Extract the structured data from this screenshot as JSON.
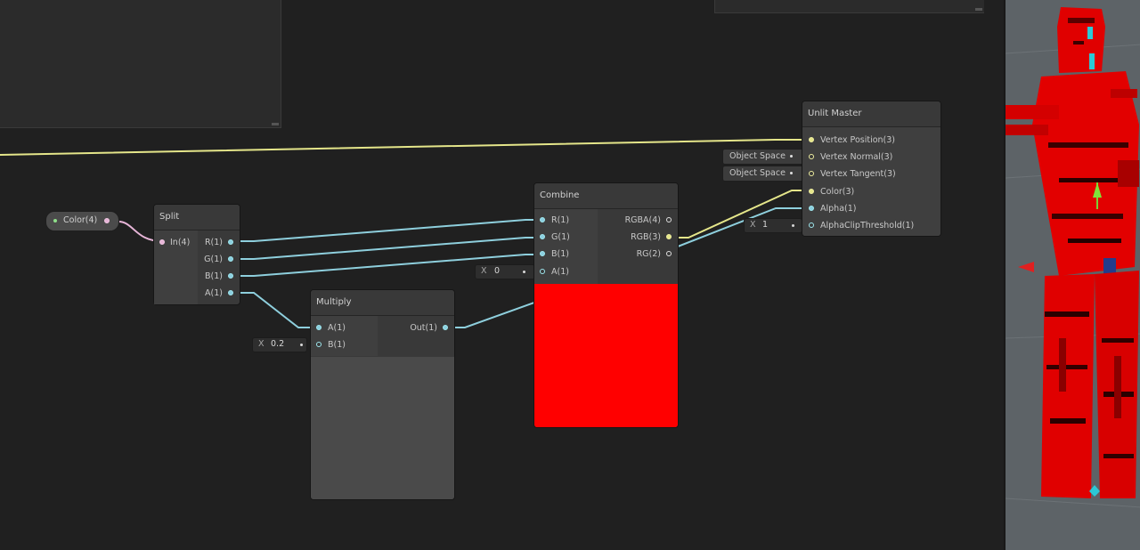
{
  "nodes": {
    "unlit_master": {
      "title": "Unlit Master",
      "inputs": [
        "Vertex Position(3)",
        "Vertex Normal(3)",
        "Vertex Tangent(3)",
        "Color(3)",
        "Alpha(1)",
        "AlphaClipThreshold(1)"
      ],
      "space_chips": [
        "Object Space",
        "Object Space"
      ],
      "alpha_clip_field": {
        "label": "X",
        "value": "1"
      }
    },
    "split": {
      "title": "Split",
      "input": "In(4)",
      "outputs": [
        "R(1)",
        "G(1)",
        "B(1)",
        "A(1)"
      ]
    },
    "combine": {
      "title": "Combine",
      "inputs": [
        "R(1)",
        "G(1)",
        "B(1)",
        "A(1)"
      ],
      "outputs": [
        "RGBA(4)",
        "RGB(3)",
        "RG(2)"
      ],
      "a_field": {
        "label": "X",
        "value": "0"
      },
      "preview_color": "#ff0000"
    },
    "multiply": {
      "title": "Multiply",
      "inputs": [
        "A(1)",
        "B(1)"
      ],
      "output": "Out(1)",
      "b_field": {
        "label": "X",
        "value": "0.2"
      }
    },
    "color_property": {
      "label": "Color(4)"
    }
  },
  "colors": {
    "wire_float": "#8ecfdd",
    "wire_vector3": "#e5e68a",
    "wire_vector4": "#e7b5d8",
    "graph_background": "#202020",
    "node_background": "#393939",
    "preview_red": "#ff0000",
    "scene_background": "#5d6367"
  }
}
